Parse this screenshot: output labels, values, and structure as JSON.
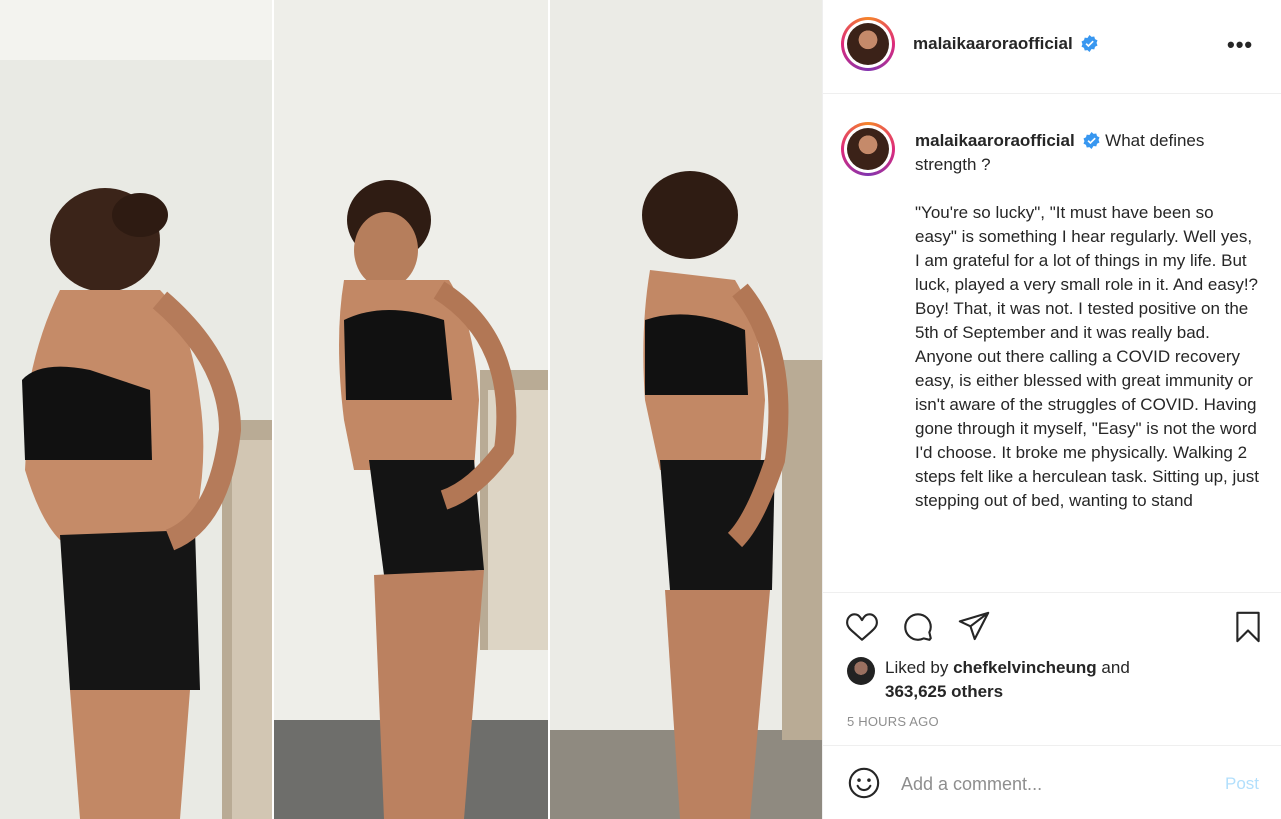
{
  "post": {
    "username": "malaikaaroraofficial",
    "verified_icon": "verified-badge-icon",
    "more_label": "•••",
    "caption_title": "What defines strength ?",
    "caption_body": "\"You're so lucky\", \"It must have been so easy\" is something I hear regularly. Well yes, I am grateful for a lot of things in my life. But luck, played a very small role in it. And easy!? Boy! That, it was not. I tested positive on the 5th of September and it was really bad. Anyone out there calling a COVID recovery easy, is either blessed with great immunity or isn't aware of the struggles of COVID. Having gone through it myself, \"Easy\" is not the word I'd choose. It broke me physically. Walking 2 steps felt like a herculean task. Sitting up, just stepping out of bed, wanting to stand",
    "likes": {
      "prefix": "Liked by",
      "user": "chefkelvincheung",
      "joiner": "and",
      "others": "363,625 others"
    },
    "timestamp": "5 HOURS AGO"
  },
  "actions": {
    "like_icon": "heart-icon",
    "comment_icon": "comment-icon",
    "share_icon": "share-icon",
    "save_icon": "bookmark-icon"
  },
  "comment": {
    "placeholder": "Add a comment...",
    "post_label": "Post",
    "emoji_icon": "emoji-icon"
  },
  "colors": {
    "accent": "#0095f6",
    "post_disabled": "#b2dffc",
    "muted": "#8e8e8e"
  }
}
